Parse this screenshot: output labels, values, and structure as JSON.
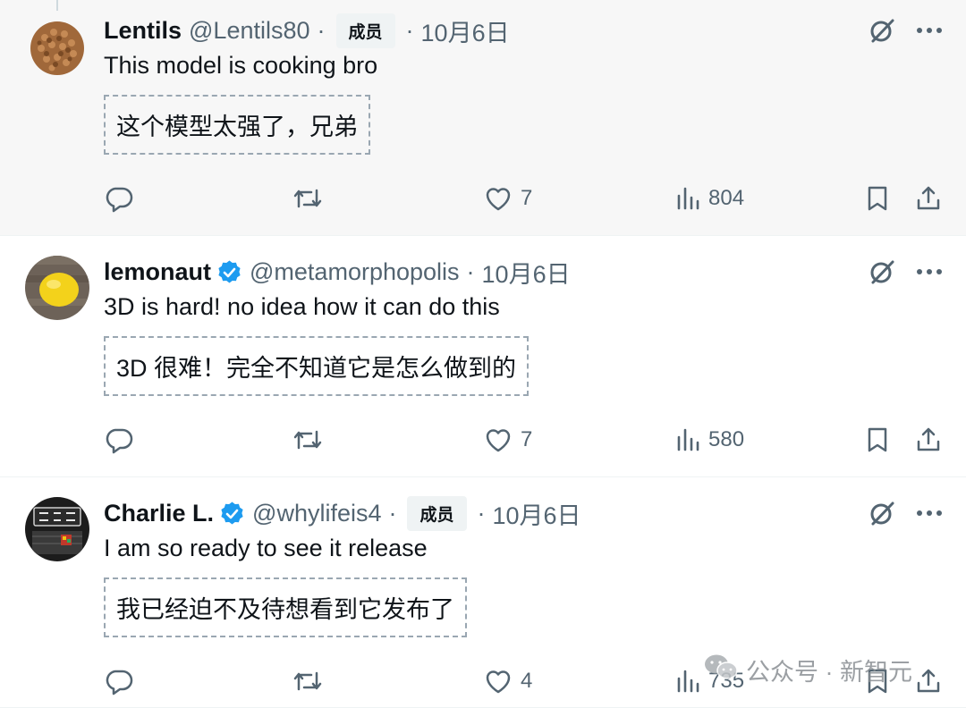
{
  "tweets": [
    {
      "name": "Lentils",
      "verified": false,
      "handle": "@Lentils80",
      "sep1": "·",
      "badge": "成员",
      "sep2": "·",
      "date": "10月6日",
      "text": "This model is cooking bro",
      "translation": "这个模型太强了，兄弟",
      "likes": "7",
      "views": "804",
      "avatar_icon": "lentils-avatar"
    },
    {
      "name": "lemonaut",
      "verified": true,
      "handle": "@metamorphopolis",
      "sep1": "",
      "badge": "",
      "sep2": "·",
      "date": "10月6日",
      "text": "3D is hard! no idea how it can do this",
      "translation": "3D 很难！完全不知道它是怎么做到的",
      "likes": "7",
      "views": "580",
      "avatar_icon": "lemon-avatar"
    },
    {
      "name": "Charlie L.",
      "verified": true,
      "handle": "@whylifeis4",
      "sep1": "·",
      "badge": "成员",
      "sep2": "·",
      "date": "10月6日",
      "text": "I am so ready to see it release",
      "translation": "我已经迫不及待想看到它发布了",
      "likes": "4",
      "views": "735",
      "avatar_icon": "zippin-pippin-avatar"
    }
  ],
  "icons": {
    "grok": "grok-icon",
    "more": "more-icon",
    "reply": "reply-icon",
    "retweet": "retweet-icon",
    "like": "like-icon",
    "views": "views-icon",
    "bookmark": "bookmark-icon",
    "share": "share-icon"
  },
  "colors": {
    "verified": "#1d9bf0",
    "secondary_text": "#536471",
    "first_row_bg": "#f7f7f7"
  },
  "watermark": {
    "text": "公众号 · 新智元"
  }
}
